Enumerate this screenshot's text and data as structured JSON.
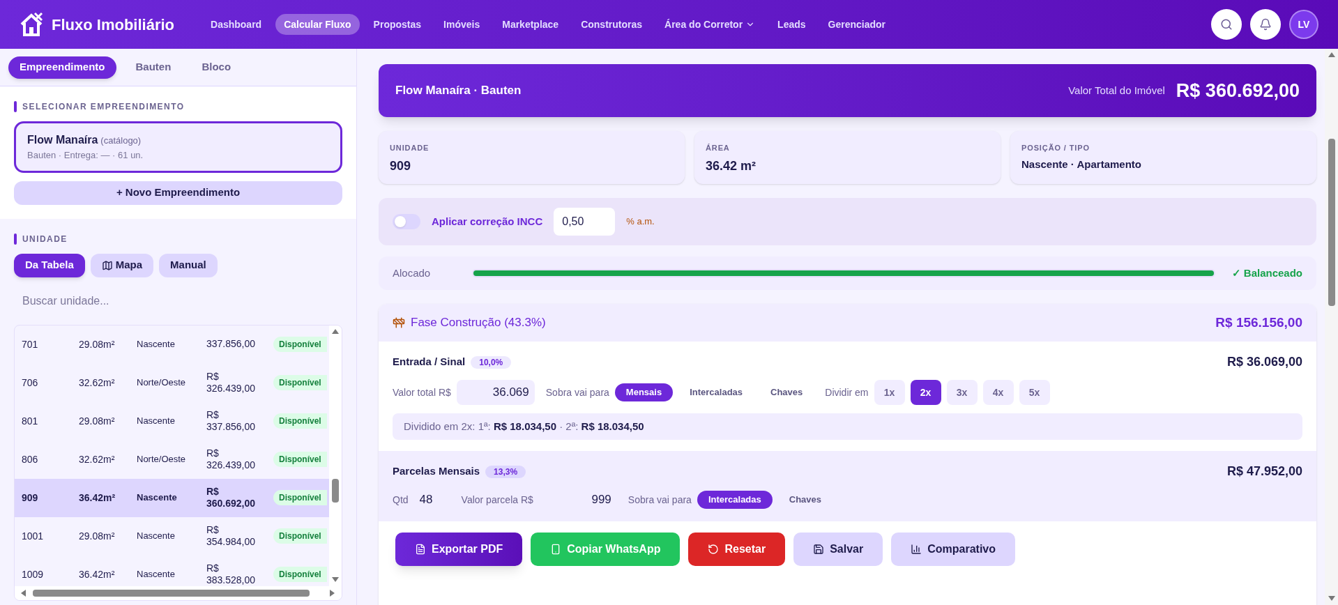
{
  "nav": {
    "brand": "Fluxo Imobiliário",
    "user_initials": "LV",
    "items": [
      {
        "label": "Dashboard",
        "selected": false,
        "kind": "link"
      },
      {
        "label": "Calcular Fluxo",
        "selected": true,
        "kind": "link"
      },
      {
        "label": "Propostas",
        "selected": false,
        "kind": "link"
      },
      {
        "label": "Imóveis",
        "selected": false,
        "kind": "link"
      },
      {
        "label": "Marketplace",
        "selected": false,
        "kind": "link"
      },
      {
        "label": "Construtoras",
        "selected": false,
        "kind": "link"
      },
      {
        "label": "Área do Corretor",
        "selected": false,
        "kind": "dropdown"
      },
      {
        "label": "Leads",
        "selected": false,
        "kind": "link"
      },
      {
        "label": "Gerenciador",
        "selected": false,
        "kind": "link"
      }
    ]
  },
  "sidebar": {
    "tabs": [
      {
        "label": "Empreendimento",
        "selected": true
      },
      {
        "label": "Bauten",
        "selected": false
      },
      {
        "label": "Bloco",
        "selected": false
      }
    ],
    "project_section_title": "SELECIONAR EMPREENDIMENTO",
    "project": {
      "name": "Flow Manaíra",
      "tag": "(catálogo)",
      "meta": "Bauten · Entrega: — · 61 un.",
      "selected": true
    },
    "new_project_button": "+ Novo Empreendimento",
    "unit_section_title": "UNIDADE",
    "unit_tabs": [
      {
        "label": "Da Tabela",
        "selected": true,
        "kind": "plain"
      },
      {
        "label": "Mapa",
        "selected": false,
        "kind": "map"
      },
      {
        "label": "Manual",
        "selected": false,
        "kind": "plain"
      }
    ],
    "search": {
      "placeholder": "Buscar unidade..."
    },
    "units": [
      {
        "unit": "701",
        "area": "29.08m²",
        "position": "Nascente",
        "price": "337.856,00",
        "status": "Disponível",
        "selected": false
      },
      {
        "unit": "706",
        "area": "32.62m²",
        "position": "Norte/Oeste",
        "price": "R$ 326.439,00",
        "status": "Disponível",
        "selected": false
      },
      {
        "unit": "801",
        "area": "29.08m²",
        "position": "Nascente",
        "price": "R$ 337.856,00",
        "status": "Disponível",
        "selected": false
      },
      {
        "unit": "806",
        "area": "32.62m²",
        "position": "Norte/Oeste",
        "price": "R$ 326.439,00",
        "status": "Disponível",
        "selected": false
      },
      {
        "unit": "909",
        "area": "36.42m²",
        "position": "Nascente",
        "price": "R$ 360.692,00",
        "status": "Disponível",
        "selected": true
      },
      {
        "unit": "1001",
        "area": "29.08m²",
        "position": "Nascente",
        "price": "R$ 354.984,00",
        "status": "Disponível",
        "selected": false
      },
      {
        "unit": "1009",
        "area": "36.42m²",
        "position": "Nascente",
        "price": "R$ 383.528,00",
        "status": "Disponível",
        "selected": false
      }
    ]
  },
  "summary": {
    "title": "Flow Manaíra · Bauten",
    "total_label": "Valor Total do Imóvel",
    "total_value": "R$ 360.692,00"
  },
  "info_cards": [
    {
      "label": "UNIDADE",
      "value": "909"
    },
    {
      "label": "ÁREA",
      "value": "36.42 m²"
    },
    {
      "label": "POSIÇÃO / TIPO",
      "value": "Nascente · Apartamento"
    }
  ],
  "incc": {
    "on": false,
    "label": "Aplicar correção INCC",
    "value": "0,50",
    "unit": "% a.m."
  },
  "allocation": {
    "label": "Alocado",
    "level": 1,
    "status": "✓ Balanceado"
  },
  "phase": {
    "title": "Fase Construção (43.3%)",
    "total": "R$ 156.156,00",
    "entrada": {
      "title": "Entrada / Sinal",
      "percent": "10,0%",
      "amount": "R$ 36.069,00",
      "value_label": "Valor total R$",
      "value": "36.069",
      "leftover_label": "Sobra vai para",
      "leftover_options": [
        {
          "label": "Mensais",
          "selected": true
        },
        {
          "label": "Intercaladas",
          "selected": false
        },
        {
          "label": "Chaves",
          "selected": false
        }
      ],
      "split_label": "Dividir em",
      "split_options": [
        {
          "label": "1x",
          "selected": false
        },
        {
          "label": "2x",
          "selected": true
        },
        {
          "label": "3x",
          "selected": false
        },
        {
          "label": "4x",
          "selected": false
        },
        {
          "label": "5x",
          "selected": false
        }
      ],
      "split_note": "Dividido em 2x: 1ª: **R$ 18.034,50** · 2ª: **R$ 18.034,50**"
    },
    "mensais": {
      "title": "Parcelas Mensais",
      "percent": "13,3%",
      "amount": "R$ 47.952,00",
      "qty_label": "Qtd",
      "qty": "48",
      "value_label": "Valor parcela R$",
      "value": "999",
      "leftover_label": "Sobra vai para",
      "leftover_options": [
        {
          "label": "Intercaladas",
          "selected": true
        },
        {
          "label": "Chaves",
          "selected": false
        }
      ]
    }
  },
  "actions": [
    {
      "label": "Exportar PDF",
      "kind": "pdf"
    },
    {
      "label": "Copiar WhatsApp",
      "kind": "whatsapp"
    },
    {
      "label": "Resetar",
      "kind": "reset"
    },
    {
      "label": "Salvar",
      "kind": "save"
    },
    {
      "label": "Comparativo",
      "kind": "compare"
    }
  ]
}
